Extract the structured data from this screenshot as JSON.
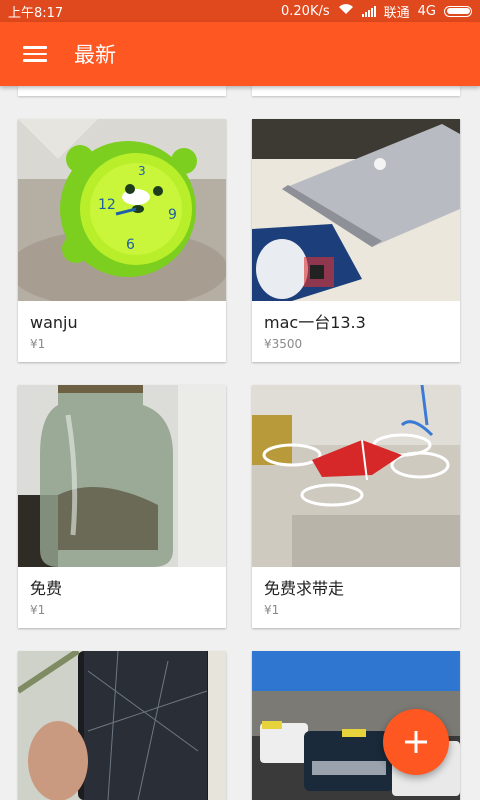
{
  "status_bar": {
    "time": "上午8:17",
    "network_speed": "0.20K/s",
    "carrier": "联通",
    "network_type": "4G",
    "icons": [
      "wifi-icon",
      "signal-icon",
      "battery-icon"
    ]
  },
  "app_bar": {
    "title": "最新",
    "menu_icon": "hamburger-menu-icon"
  },
  "listings": [
    {
      "name": "wanju",
      "price": "¥1",
      "image": "green-clock-toy"
    },
    {
      "name": "mac一台13.3",
      "price": "¥3500",
      "image": "laptop-on-desk"
    },
    {
      "name": "免费",
      "price": "¥1",
      "image": "glass-jar"
    },
    {
      "name": "免费求带走",
      "price": "¥1",
      "image": "toy-drone"
    },
    {
      "name": "",
      "price": "",
      "image": "cracked-phone"
    },
    {
      "name": "",
      "price": "",
      "image": "cars-parking-lot"
    }
  ],
  "fab": {
    "icon": "add-icon"
  },
  "colors": {
    "primary": "#ff5722",
    "status_bar": "#e0481d"
  }
}
